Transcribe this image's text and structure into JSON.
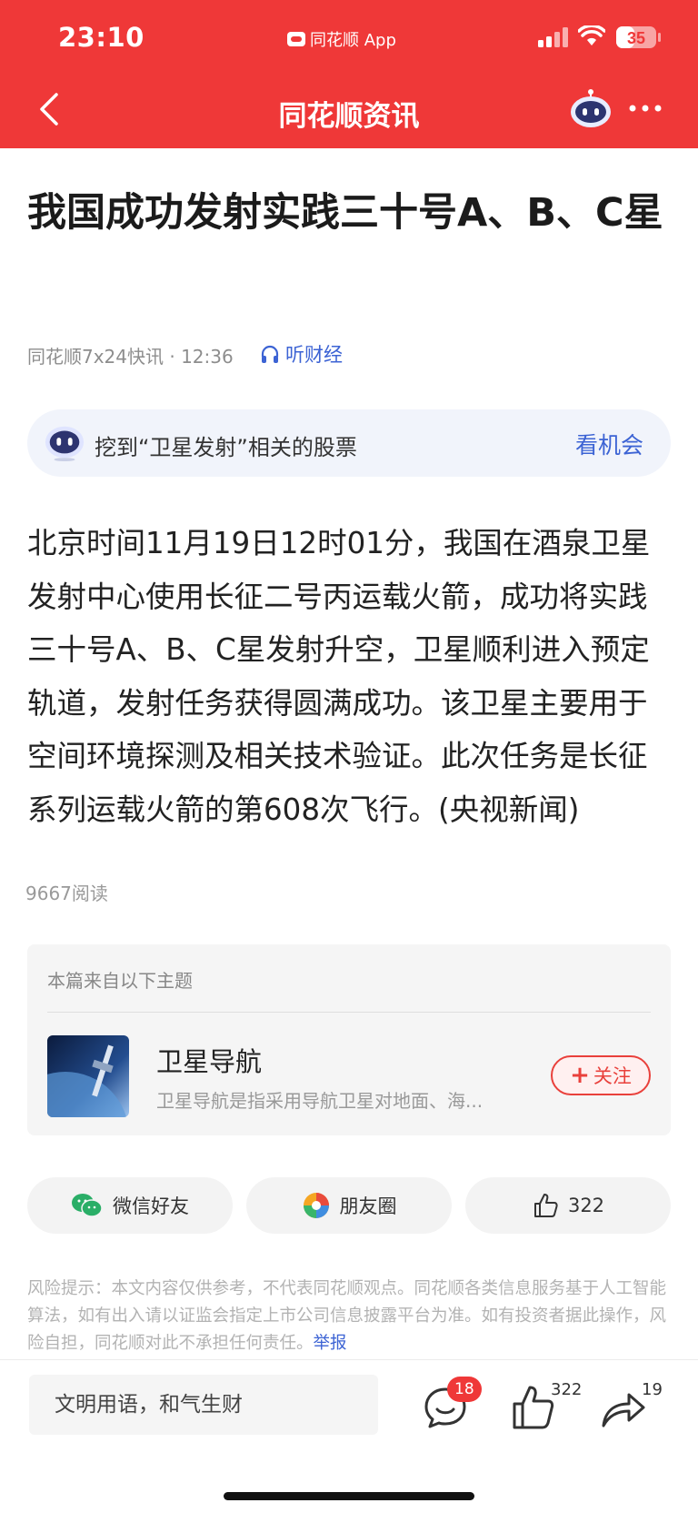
{
  "status_bar": {
    "time": "23:10",
    "carrier_app": "同花顺 App",
    "battery": "35"
  },
  "nav": {
    "title": "同花顺资讯"
  },
  "article": {
    "headline": "我国成功发射实践三十号A、B、C星",
    "source_time": "同花顺7x24快讯 · 12:36",
    "listen_label": "听财经",
    "promo_text": "挖到“卫星发射”相关的股票",
    "promo_link": "看机会",
    "body": "北京时间11月19日12时01分，我国在酒泉卫星发射中心使用长征二号丙运载火箭，成功将实践三十号A、B、C星发射升空，卫星顺利进入预定轨道，发射任务获得圆满成功。该卫星主要用于空间环境探测及相关技术验证。此次任务是长征系列运载火箭的第608次飞行。(央视新闻)",
    "reads": "9667阅读"
  },
  "topic_card": {
    "heading": "本篇来自以下主题",
    "name": "卫星导航",
    "description": "卫星导航是指采用导航卫星对地面、海...",
    "follow_label": "关注"
  },
  "share": {
    "wechat_label": "微信好友",
    "moments_label": "朋友圈",
    "like_count": "322"
  },
  "risk": {
    "text": "风险提示：本文内容仅供参考，不代表同花顺观点。同花顺各类信息服务基于人工智能算法，如有出入请以证监会指定上市公司信息披露平台为准。如有投资者据此操作，风险自担，同花顺对此不承担任何责任。",
    "report_label": "举报"
  },
  "bottom_bar": {
    "comment_placeholder": "文明用语，和气生财",
    "comment_count": "18",
    "like_count": "322",
    "share_count": "19"
  },
  "colors": {
    "brand_red": "#ef3838",
    "link_blue": "#3c63d4"
  },
  "icons": [
    "back-arrow-icon",
    "robot-icon",
    "more-dots-icon",
    "headphones-icon",
    "wechat-icon",
    "moments-icon",
    "thumbs-up-icon",
    "comment-icon",
    "share-arrow-icon"
  ]
}
